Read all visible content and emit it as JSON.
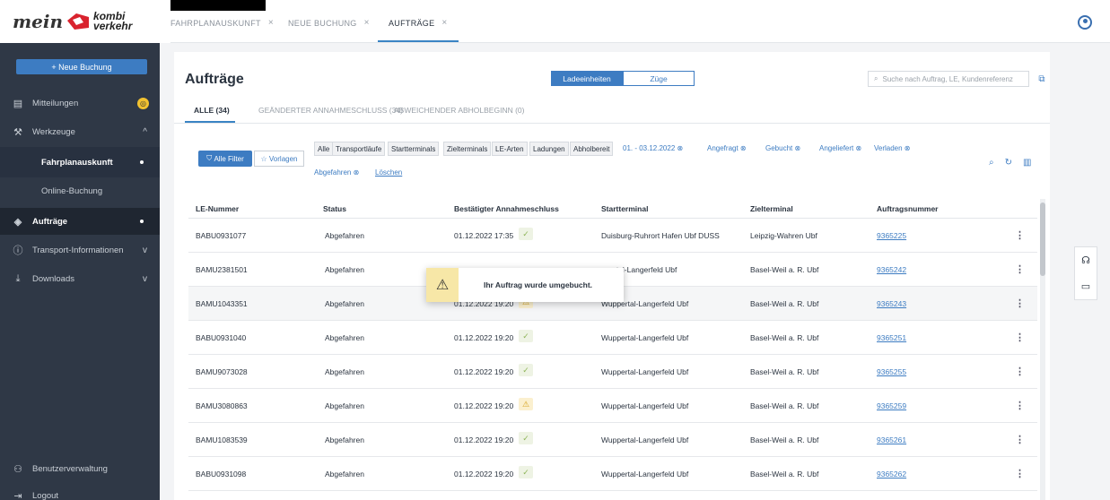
{
  "logo": {
    "prefix": "mein",
    "line1": "kombi",
    "line2": "verkehr"
  },
  "top_tabs": [
    {
      "label": "FAHRPLANAUSKUNFT",
      "close": "×"
    },
    {
      "label": "NEUE BUCHUNG",
      "close": "×"
    },
    {
      "label": "AUFTRÄGE",
      "close": "×"
    }
  ],
  "sidebar": {
    "new_booking": "+ Neue Buchung",
    "items": [
      {
        "label": "Mitteilungen",
        "icon": "document-icon"
      },
      {
        "label": "Werkzeuge",
        "icon": "wrench-icon",
        "trail": "^"
      },
      {
        "label": "Fahrplanauskunft"
      },
      {
        "label": "Online-Buchung"
      },
      {
        "label": "Aufträge",
        "icon": "box-icon"
      },
      {
        "label": "Transport-Informationen",
        "icon": "info-icon",
        "trail": "v"
      },
      {
        "label": "Downloads",
        "icon": "download-icon",
        "trail": "v"
      },
      {
        "label": "Benutzerverwaltung",
        "icon": "users-icon"
      },
      {
        "label": "Logout",
        "icon": "logout-icon"
      }
    ],
    "badge": "◎",
    "accent": "#f2c230"
  },
  "main": {
    "title": "Aufträge",
    "segment": {
      "a": "Ladeeinheiten",
      "b": "Züge"
    },
    "search_placeholder": "Suche nach Auftrag, LE, Kundenreferenz",
    "filter_tabs": [
      "ALLE (34)",
      "GEÄNDERTER ANNAHMESCHLUSS (34)",
      "ABWEICHENDER ABHOLBEGINN (0)"
    ],
    "all_filter": "Alle Filter",
    "templates": "Vorlagen",
    "chips": [
      "Alle",
      "Transportläufe",
      "Startterminals",
      "Zielterminals",
      "LE-Arten",
      "Ladungen",
      "Abholbereit"
    ],
    "filters": [
      "01. - 03.12.2022 ⊗",
      "Angefragt ⊗",
      "Gebucht ⊗",
      "Angeliefert ⊗",
      "Verladen ⊗"
    ],
    "filters2": [
      "Abgefahren ⊗",
      "Löschen"
    ],
    "columns": [
      "LE-Nummer",
      "Status",
      "Bestätigter Annahmeschluss",
      "Startterminal",
      "Zielterminal",
      "Auftragsnummer"
    ],
    "rows": [
      {
        "le": "BABU0931077",
        "status": "Abgefahren",
        "deadline": "01.12.2022 17:35",
        "flag": "ok",
        "start": "Duisburg-Ruhrort Hafen Ubf DUSS",
        "ziel": "Leipzig-Wahren Ubf",
        "nr": "9365225"
      },
      {
        "le": "BAMU2381501",
        "status": "Abgefahren",
        "deadline": "",
        "flag": "",
        "start": "rtal-Langerfeld Ubf",
        "ziel": "Basel-Weil a. R. Ubf",
        "nr": "9365242"
      },
      {
        "le": "BAMU1043351",
        "status": "Abgefahren",
        "deadline": "01.12.2022 19:20",
        "flag": "warn",
        "start": "Wuppertal-Langerfeld Ubf",
        "ziel": "Basel-Weil a. R. Ubf",
        "nr": "9365243"
      },
      {
        "le": "BABU0931040",
        "status": "Abgefahren",
        "deadline": "01.12.2022 19:20",
        "flag": "ok",
        "start": "Wuppertal-Langerfeld Ubf",
        "ziel": "Basel-Weil a. R. Ubf",
        "nr": "9365251"
      },
      {
        "le": "BAMU9073028",
        "status": "Abgefahren",
        "deadline": "01.12.2022 19:20",
        "flag": "ok",
        "start": "Wuppertal-Langerfeld Ubf",
        "ziel": "Basel-Weil a. R. Ubf",
        "nr": "9365255"
      },
      {
        "le": "BAMU3080863",
        "status": "Abgefahren",
        "deadline": "01.12.2022 19:20",
        "flag": "warn",
        "start": "Wuppertal-Langerfeld Ubf",
        "ziel": "Basel-Weil a. R. Ubf",
        "nr": "9365259"
      },
      {
        "le": "BAMU1083539",
        "status": "Abgefahren",
        "deadline": "01.12.2022 19:20",
        "flag": "ok",
        "start": "Wuppertal-Langerfeld Ubf",
        "ziel": "Basel-Weil a. R. Ubf",
        "nr": "9365261"
      },
      {
        "le": "BABU0931098",
        "status": "Abgefahren",
        "deadline": "01.12.2022 19:20",
        "flag": "ok",
        "start": "Wuppertal-Langerfeld Ubf",
        "ziel": "Basel-Weil a. R. Ubf",
        "nr": "9365262"
      }
    ]
  },
  "toast": {
    "message": "Ihr Auftrag wurde umgebucht.",
    "icon": "warning-icon"
  },
  "colors": {
    "primary": "#3d7cc2",
    "sidebar": "#2f3846",
    "warning": "#f7e7a7"
  }
}
